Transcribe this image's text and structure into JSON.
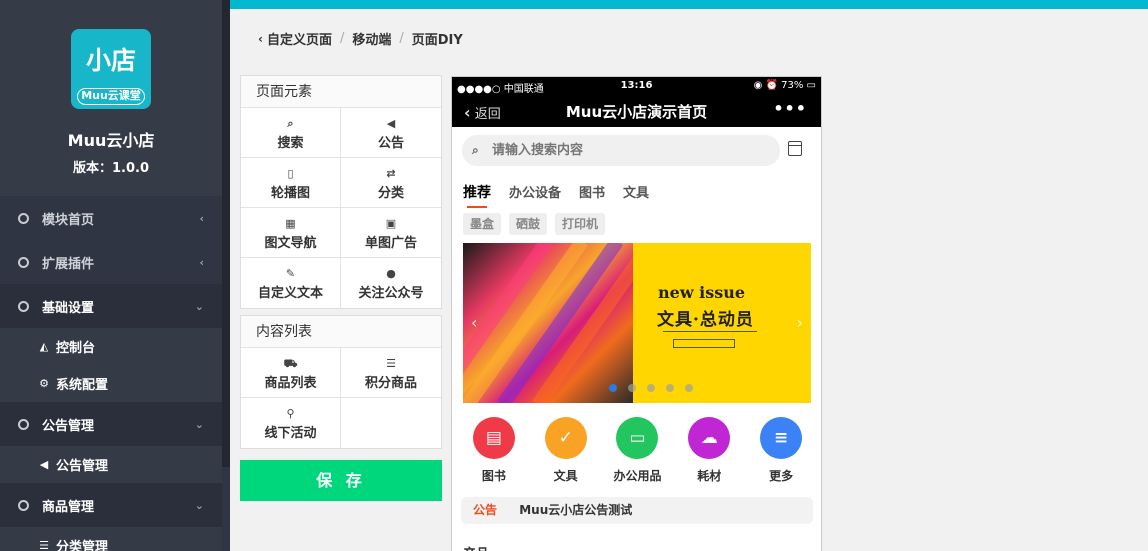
{
  "sidebar": {
    "logo_text": "小店",
    "logo_sub": "Muu云课堂",
    "app_name": "Muu云小店",
    "version": "版本：1.0.0",
    "menu": [
      {
        "label": "模块首页",
        "open": false
      },
      {
        "label": "扩展插件",
        "open": false
      },
      {
        "label": "基础设置",
        "open": true,
        "sub": [
          "控制台",
          "系统配置"
        ]
      },
      {
        "label": "公告管理",
        "open": true,
        "sub": [
          "公告管理"
        ]
      },
      {
        "label": "商品管理",
        "open": true,
        "sub": [
          "分类管理"
        ]
      }
    ]
  },
  "breadcrumb": [
    "自定义页面",
    "移动端",
    "页面DIY"
  ],
  "elements_panel": {
    "title": "页面元素",
    "items": [
      {
        "label": "搜索",
        "icon": "search-icon"
      },
      {
        "label": "公告",
        "icon": "megaphone-icon"
      },
      {
        "label": "轮播图",
        "icon": "file-image-icon"
      },
      {
        "label": "分类",
        "icon": "exchange-icon"
      },
      {
        "label": "图文导航",
        "icon": "grid-icon"
      },
      {
        "label": "单图广告",
        "icon": "picture-icon"
      },
      {
        "label": "自定义文本",
        "icon": "edit-icon"
      },
      {
        "label": "关注公众号",
        "icon": "wechat-icon"
      }
    ]
  },
  "content_panel": {
    "title": "内容列表",
    "items": [
      {
        "label": "商品列表",
        "icon": "cart-icon"
      },
      {
        "label": "积分商品",
        "icon": "database-icon"
      },
      {
        "label": "线下活动",
        "icon": "map-marker-icon"
      },
      {
        "label": "",
        "icon": ""
      }
    ]
  },
  "save_label": "保 存",
  "phone": {
    "carrier": "●●●●○ 中国联通",
    "time": "13:16",
    "battery": "73%",
    "back": "返回",
    "title": "Muu云小店演示首页",
    "search_placeholder": "请输入搜索内容",
    "tabs": [
      "推荐",
      "办公设备",
      "图书",
      "文具"
    ],
    "chips": [
      "墨盒",
      "硒鼓",
      "打印机"
    ],
    "banner": {
      "line1": "new issue",
      "line2": "文具·总动员",
      "slides": 5,
      "active": 0
    },
    "icons": [
      {
        "label": "图书",
        "color": "#f03a47",
        "glyph": "▤"
      },
      {
        "label": "文具",
        "color": "#f8a326",
        "glyph": "✓"
      },
      {
        "label": "办公用品",
        "color": "#22c55e",
        "glyph": "▭"
      },
      {
        "label": "耗材",
        "color": "#c026d3",
        "glyph": "☁"
      },
      {
        "label": "更多",
        "color": "#3b82f6",
        "glyph": "≡"
      }
    ],
    "notice_tag": "公告",
    "notice_text": "Muu云小店公告测试",
    "section_peek": "产品"
  }
}
